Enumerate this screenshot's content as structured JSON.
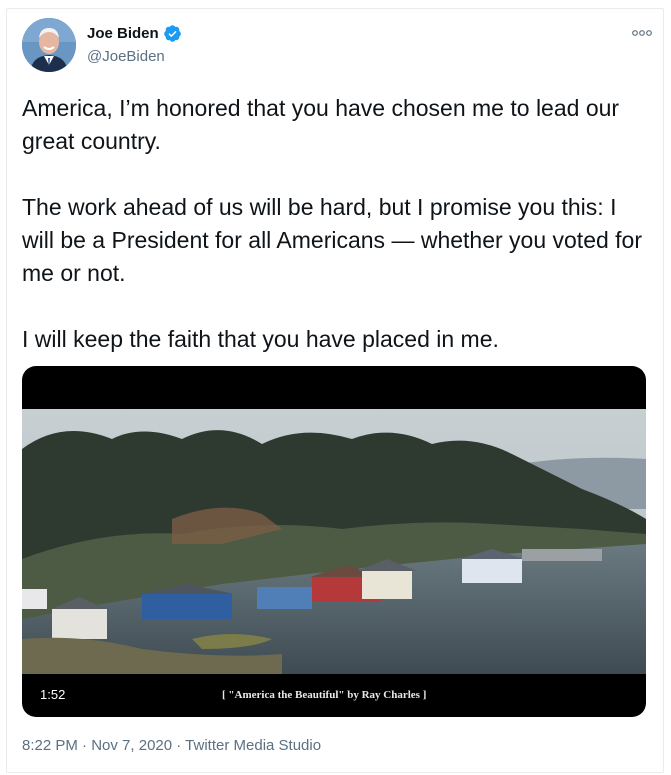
{
  "author": {
    "name": "Joe Biden",
    "handle": "@JoeBiden",
    "verified_icon": "verified-badge-icon",
    "avatar_icon": "profile-photo"
  },
  "tweet": {
    "text": "America, I’m honored that you have chosen me to lead our great country.\n\nThe work ahead of us will be hard, but I promise you this: I will be a President for all Americans — whether you voted for me or not.\n\nI will keep the faith that you have placed in me."
  },
  "media": {
    "duration": "1:52",
    "caption": "[ \"America the Beautiful\" by Ray Charles ]"
  },
  "meta": {
    "time": "8:22 PM",
    "separator1": " · ",
    "date": "Nov 7, 2020",
    "separator2": " · ",
    "source": "Twitter Media Studio"
  },
  "colors": {
    "verified": "#1d9bf0",
    "secondary_text": "#5b7083",
    "border": "#e6ecf0"
  }
}
